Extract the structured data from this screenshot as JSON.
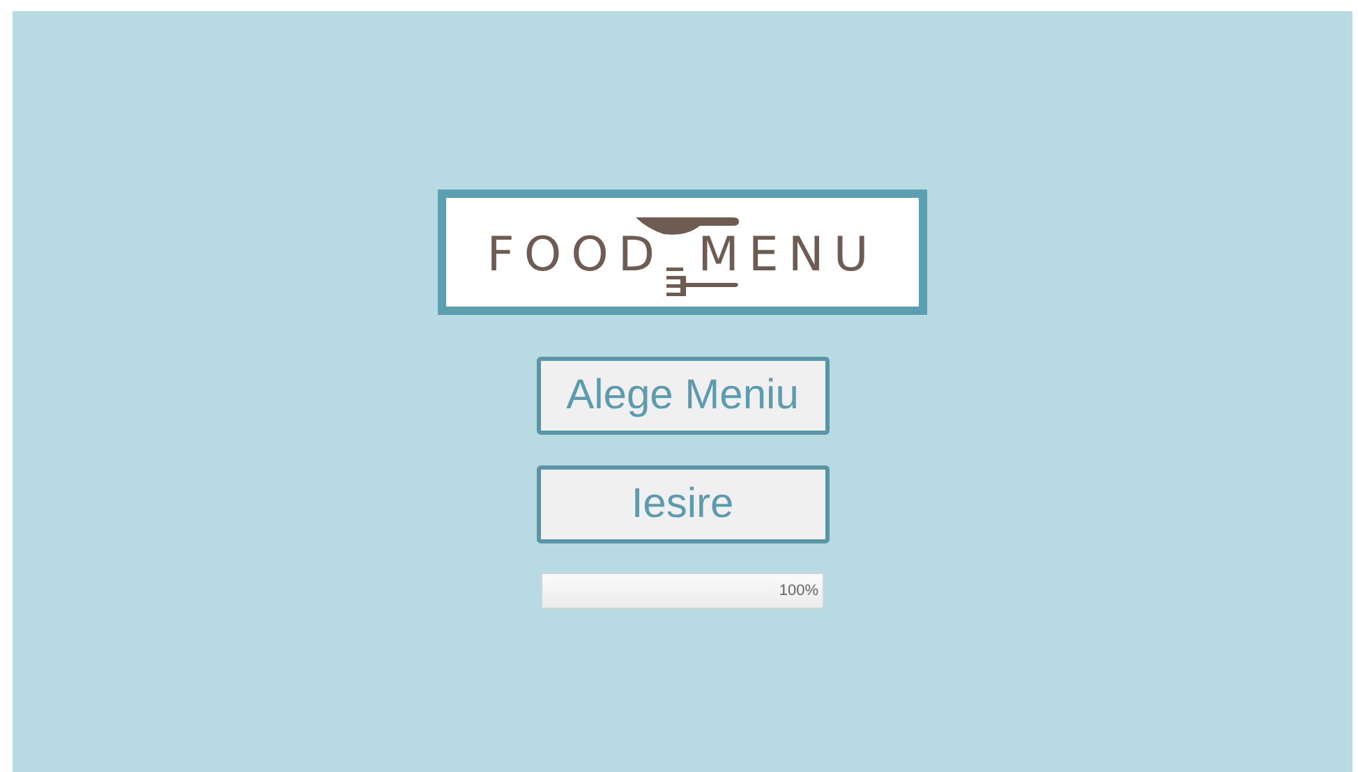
{
  "logo": {
    "word_1": "FOOD",
    "word_2": "MENU"
  },
  "buttons": [
    {
      "label": "Alege Meniu"
    },
    {
      "label": "Iesire"
    }
  ],
  "progress": {
    "level": 1,
    "reading": "100%"
  }
}
